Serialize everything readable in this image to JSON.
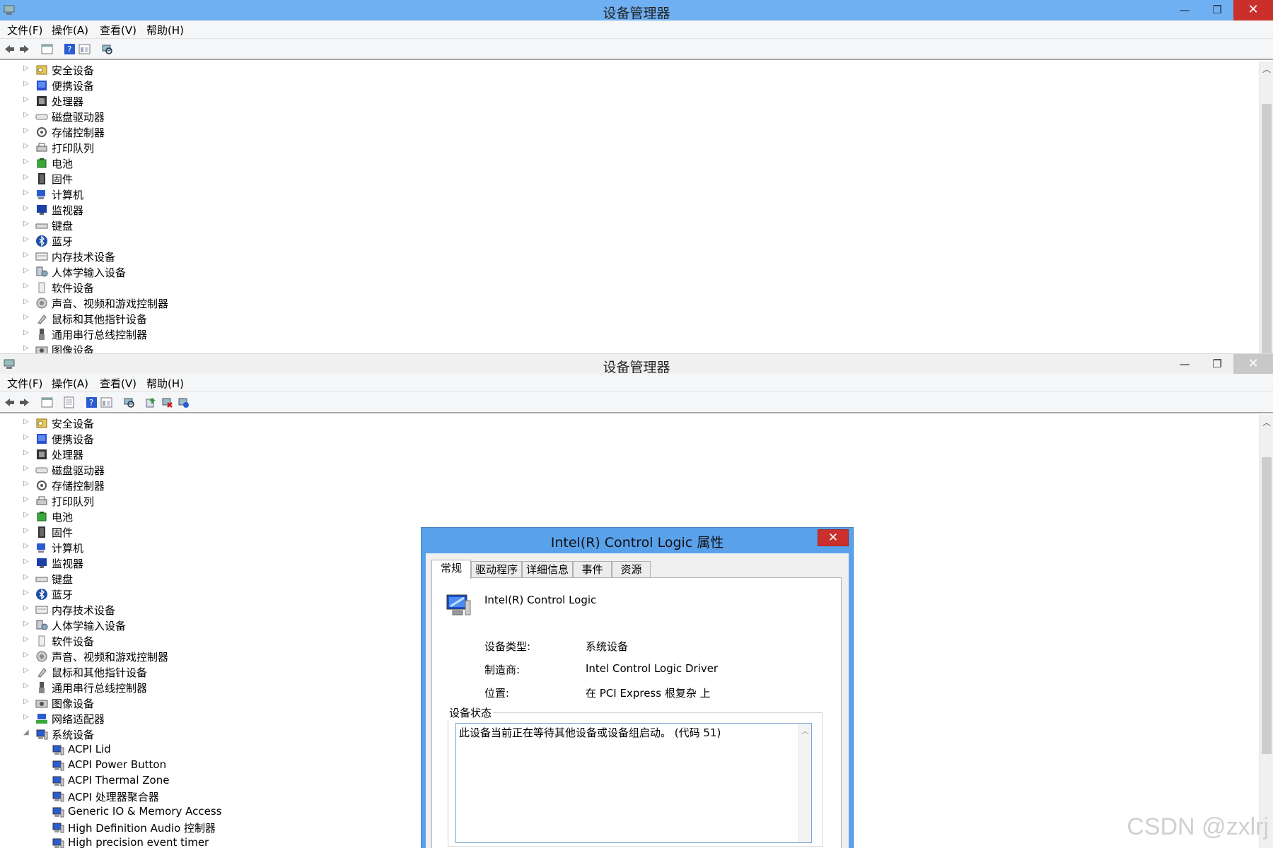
{
  "window_title": "设备管理器",
  "menu": [
    "文件(F)",
    "操作(A)",
    "查看(V)",
    "帮助(H)"
  ],
  "window_buttons": {
    "minimize": "—",
    "maximize": "❐",
    "close": "✕"
  },
  "tree_top": [
    {
      "label": "安全设备",
      "icon": "security-icon"
    },
    {
      "label": "便携设备",
      "icon": "portable-device-icon"
    },
    {
      "label": "处理器",
      "icon": "processor-icon"
    },
    {
      "label": "磁盘驱动器",
      "icon": "disk-drive-icon"
    },
    {
      "label": "存储控制器",
      "icon": "storage-controller-icon"
    },
    {
      "label": "打印队列",
      "icon": "printer-icon"
    },
    {
      "label": "电池",
      "icon": "battery-icon"
    },
    {
      "label": "固件",
      "icon": "firmware-icon"
    },
    {
      "label": "计算机",
      "icon": "computer-icon"
    },
    {
      "label": "监视器",
      "icon": "monitor-icon"
    },
    {
      "label": "键盘",
      "icon": "keyboard-icon"
    },
    {
      "label": "蓝牙",
      "icon": "bluetooth-icon"
    },
    {
      "label": "内存技术设备",
      "icon": "memory-icon"
    },
    {
      "label": "人体学输入设备",
      "icon": "hid-icon"
    },
    {
      "label": "软件设备",
      "icon": "software-device-icon"
    },
    {
      "label": "声音、视频和游戏控制器",
      "icon": "sound-icon"
    },
    {
      "label": "鼠标和其他指针设备",
      "icon": "mouse-icon"
    },
    {
      "label": "通用串行总线控制器",
      "icon": "usb-icon"
    },
    {
      "label": "图像设备",
      "icon": "imaging-icon"
    }
  ],
  "tree_bottom_extra": [
    {
      "label": "网络适配器",
      "icon": "network-icon"
    },
    {
      "label": "系统设备",
      "icon": "system-device-icon"
    }
  ],
  "system_children": [
    "ACPI Lid",
    "ACPI Power Button",
    "ACPI Thermal Zone",
    "ACPI 处理器聚合器",
    "Generic IO & Memory Access",
    "High Definition Audio 控制器",
    "High precision event timer"
  ],
  "dialog": {
    "title": "Intel(R) Control Logic 属性",
    "close": "✕",
    "tabs": [
      "常规",
      "驱动程序",
      "详细信息",
      "事件",
      "资源"
    ],
    "device_name": "Intel(R) Control Logic",
    "props": [
      {
        "label": "设备类型:",
        "value": "系统设备"
      },
      {
        "label": "制造商:",
        "value": "Intel Control Logic Driver"
      },
      {
        "label": "位置:",
        "value": "在 PCI Express 根复杂 上"
      }
    ],
    "status_group_title": "设备状态",
    "status_text": "此设备当前正在等待其他设备或设备组启动。 (代码 51)"
  },
  "watermark": "CSDN @zxlrj",
  "colors": {
    "active_title": "#6fb0f2",
    "close_red": "#c9302c",
    "dialog_frame": "#5aa1ec"
  }
}
